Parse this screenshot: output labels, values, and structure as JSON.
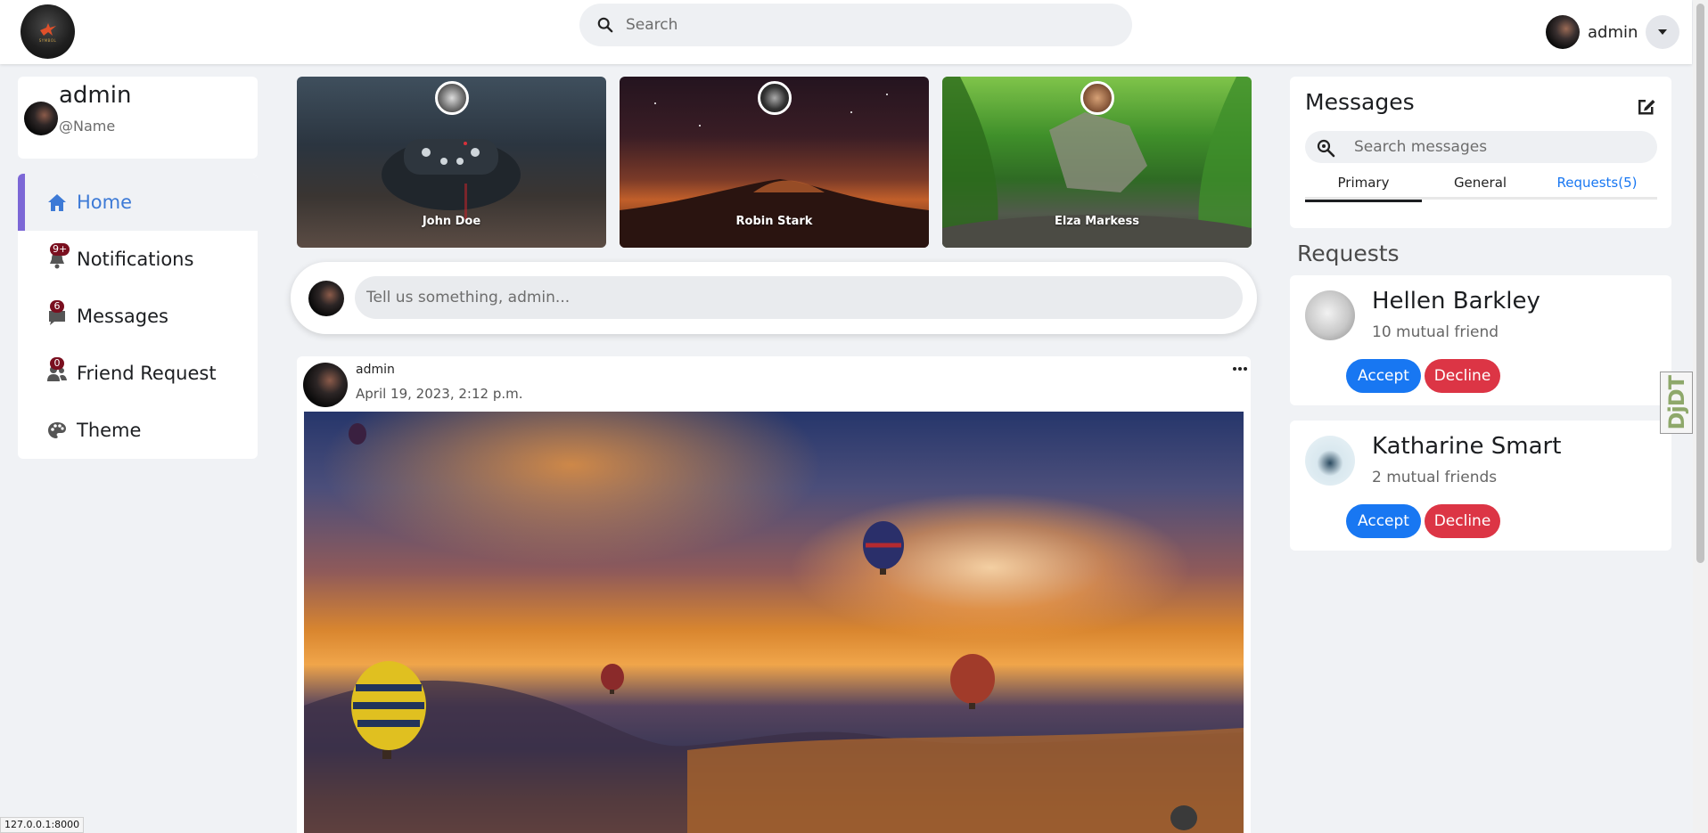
{
  "navbar": {
    "logo_text": "SYMBOL",
    "search_placeholder": "Search",
    "username": "admin"
  },
  "profile": {
    "name": "admin",
    "handle": "@Name"
  },
  "sidebar": {
    "items": [
      {
        "label": "Home",
        "icon": "home-icon",
        "badge": ""
      },
      {
        "label": "Notifications",
        "icon": "bell-icon",
        "badge": "9+"
      },
      {
        "label": "Messages",
        "icon": "chat-icon",
        "badge": "6"
      },
      {
        "label": "Friend Request",
        "icon": "users-icon",
        "badge": "0"
      },
      {
        "label": "Theme",
        "icon": "palette-icon",
        "badge": ""
      }
    ]
  },
  "stories": [
    {
      "name": "John Doe"
    },
    {
      "name": "Robin Stark"
    },
    {
      "name": "Elza Markess"
    }
  ],
  "composer": {
    "placeholder": "Tell us something, admin..."
  },
  "post": {
    "author": "admin",
    "date": "April 19, 2023, 2:12 p.m."
  },
  "messages": {
    "title": "Messages",
    "search_placeholder": "Search messages",
    "tabs": [
      "Primary",
      "General",
      "Requests(5)"
    ],
    "active_tab": "Primary"
  },
  "requests": {
    "heading": "Requests",
    "items": [
      {
        "name": "Hellen Barkley",
        "mutual": "10 mutual friend",
        "accept": "Accept",
        "decline": "Decline"
      },
      {
        "name": "Katharine Smart",
        "mutual": "2 mutual friends",
        "accept": "Accept",
        "decline": "Decline"
      }
    ]
  },
  "debug_toolbar": {
    "label": "DjDT"
  },
  "status_bar": {
    "url": "127.0.0.1:8000"
  },
  "colors": {
    "accent": "#3d7ad6",
    "active_bar": "#7c67d6",
    "primary_button": "#1877f2",
    "danger_button": "#dc3545",
    "badge": "#7a0f1f"
  }
}
